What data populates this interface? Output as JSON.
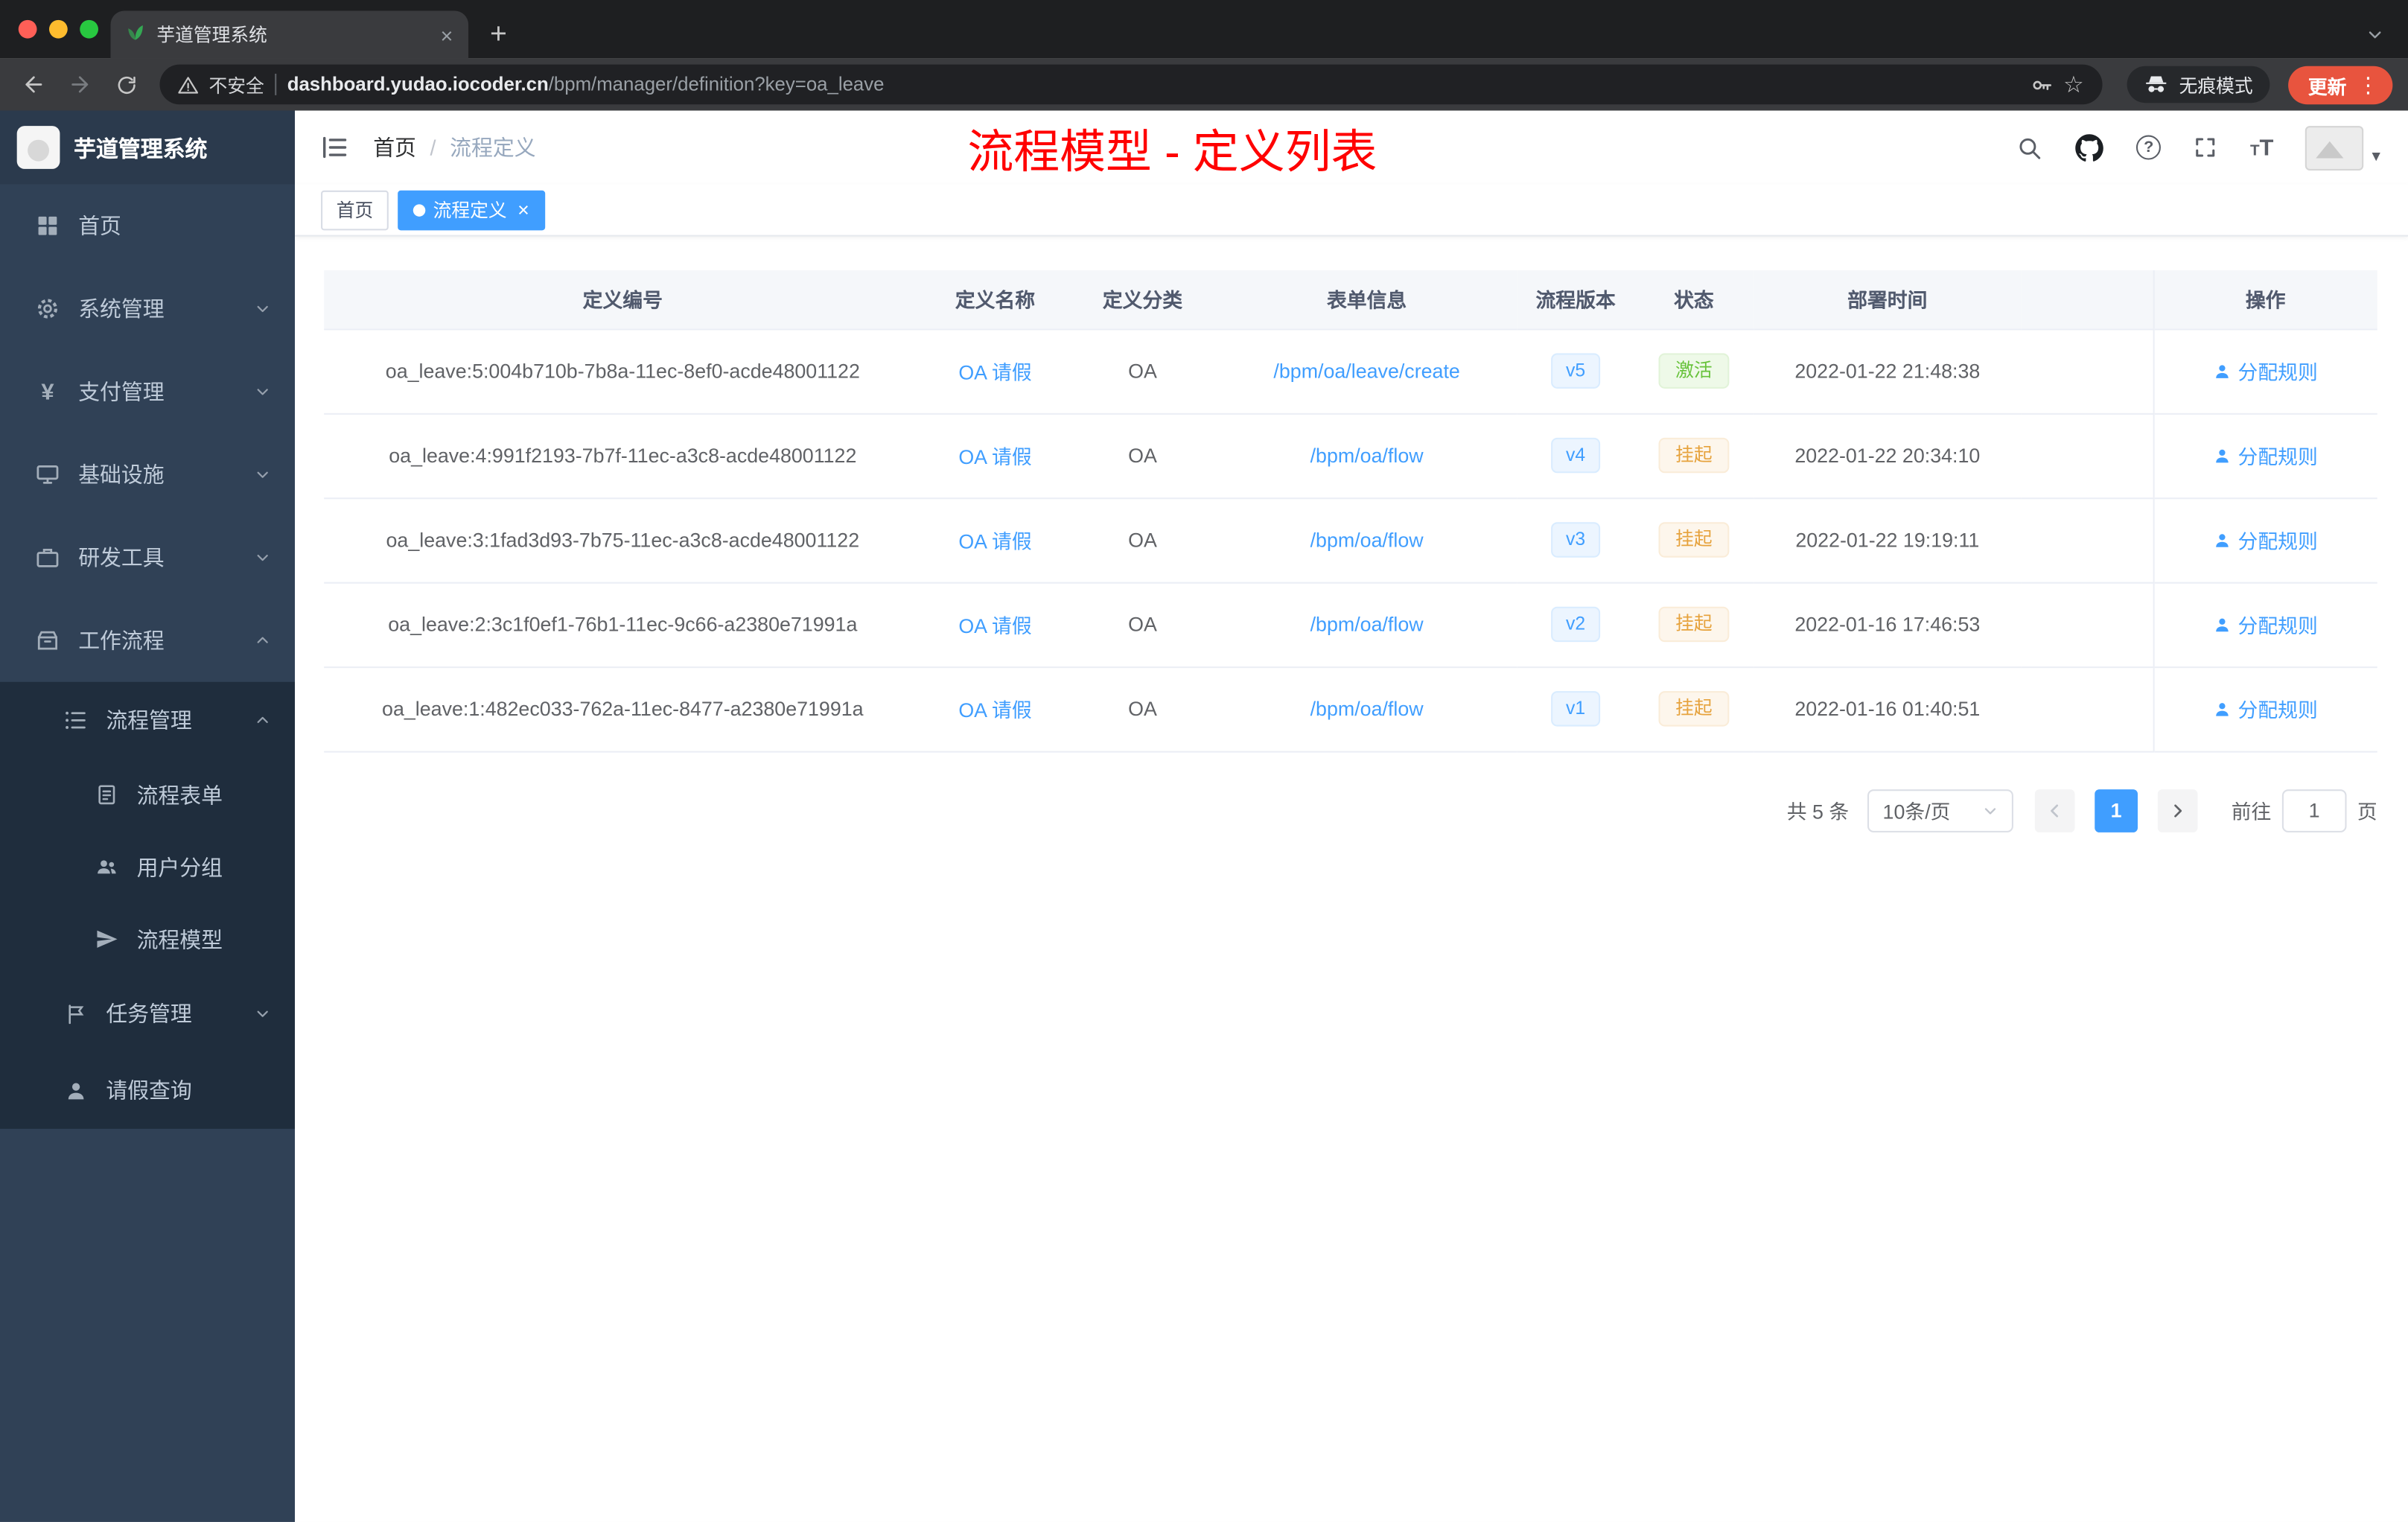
{
  "browser": {
    "tab_title": "芋道管理系统",
    "security_label": "不安全",
    "url_host": "dashboard.yudao.iocoder.cn",
    "url_path": "/bpm/manager/definition?key=oa_leave",
    "incognito_label": "无痕模式",
    "update_label": "更新"
  },
  "icons": {
    "close": "×",
    "plus": "+",
    "star": "☆",
    "kebab": "⋮",
    "slash": "/",
    "help": "?",
    "caret_down": "▾",
    "yen": "¥",
    "font_large": "T",
    "font_small": "T"
  },
  "sidebar": {
    "logo_title": "芋道管理系统",
    "items": [
      {
        "label": "首页"
      },
      {
        "label": "系统管理"
      },
      {
        "label": "支付管理"
      },
      {
        "label": "基础设施"
      },
      {
        "label": "研发工具"
      },
      {
        "label": "工作流程",
        "expanded": true
      }
    ],
    "workflow_submenu": {
      "process_mgmt": {
        "label": "流程管理",
        "expanded": true,
        "children": [
          {
            "label": "流程表单"
          },
          {
            "label": "用户分组"
          },
          {
            "label": "流程模型"
          }
        ]
      },
      "task_mgmt": {
        "label": "任务管理"
      },
      "leave_query": {
        "label": "请假查询"
      }
    }
  },
  "header": {
    "breadcrumb": [
      "首页",
      "流程定义"
    ],
    "annotation": "流程模型 - 定义列表"
  },
  "tags": [
    {
      "label": "首页",
      "active": false
    },
    {
      "label": "流程定义",
      "active": true
    }
  ],
  "table": {
    "columns": [
      "定义编号",
      "定义名称",
      "定义分类",
      "表单信息",
      "流程版本",
      "状态",
      "部署时间",
      "操作"
    ],
    "action_label": "分配规则",
    "rows": [
      {
        "id": "oa_leave:5:004b710b-7b8a-11ec-8ef0-acde48001122",
        "name": "OA 请假",
        "category": "OA",
        "form": "/bpm/oa/leave/create",
        "version": "v5",
        "status": "激活",
        "status_type": "success",
        "time": "2022-01-22 21:48:38"
      },
      {
        "id": "oa_leave:4:991f2193-7b7f-11ec-a3c8-acde48001122",
        "name": "OA 请假",
        "category": "OA",
        "form": "/bpm/oa/flow",
        "version": "v4",
        "status": "挂起",
        "status_type": "warning",
        "time": "2022-01-22 20:34:10"
      },
      {
        "id": "oa_leave:3:1fad3d93-7b75-11ec-a3c8-acde48001122",
        "name": "OA 请假",
        "category": "OA",
        "form": "/bpm/oa/flow",
        "version": "v3",
        "status": "挂起",
        "status_type": "warning",
        "time": "2022-01-22 19:19:11"
      },
      {
        "id": "oa_leave:2:3c1f0ef1-76b1-11ec-9c66-a2380e71991a",
        "name": "OA 请假",
        "category": "OA",
        "form": "/bpm/oa/flow",
        "version": "v2",
        "status": "挂起",
        "status_type": "warning",
        "time": "2022-01-16 17:46:53"
      },
      {
        "id": "oa_leave:1:482ec033-762a-11ec-8477-a2380e71991a",
        "name": "OA 请假",
        "category": "OA",
        "form": "/bpm/oa/flow",
        "version": "v1",
        "status": "挂起",
        "status_type": "warning",
        "time": "2022-01-16 01:40:51"
      }
    ]
  },
  "pagination": {
    "total": "共 5 条",
    "page_size": "10条/页",
    "current_page": "1",
    "goto_label": "前往",
    "goto_value": "1",
    "unit_label": "页"
  },
  "colors": {
    "accent": "#409eff",
    "success": "#67c23a",
    "warning": "#e6a23c",
    "annotation": "#ff0000",
    "sidebar_bg": "#304156",
    "submenu_bg": "#1f2d3d"
  }
}
